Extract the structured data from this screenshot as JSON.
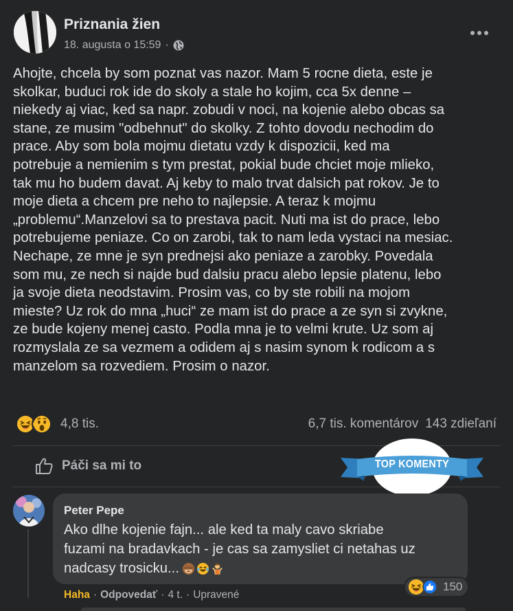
{
  "post": {
    "page_name": "Priznania žien",
    "date": "18. augusta o 15:59",
    "separator": "·",
    "privacy_icon": "globe-icon",
    "text": "Ahojte, chcela by som poznat vas nazor. Mam 5 rocne dieta, este je\nskolkar, buduci rok ide do skoly a stale ho kojim, cca 5x denne –\nniekedy aj viac, ked sa napr. zobudi v noci, na kojenie alebo obcas sa\nstane, ze musim \"odbehnut\" do skolky.  Z tohto dovodu nechodim do\nprace. Aby som bola mojmu dietatu vzdy k dispozicii, ked ma\npotrebuje a nemienim s tym prestat, pokial bude chciet moje mlieko,\ntak mu ho budem davat. Aj keby to malo trvat dalsich pat rokov. Je to\nmoje dieta a chcem pre neho to najlepsie. A teraz k mojmu\n„problemu“.Manzelovi sa to prestava pacit. Nuti ma ist do prace, lebo\npotrebujeme peniaze. Co on zarobi, tak to nam leda vystaci na mesiac.\nNechape, ze mne je syn prednejsi ako peniaze a zarobky. Povedala\nsom mu, ze nech si najde bud dalsiu pracu alebo lepsie platenu, lebo\nja svoje dieta neodstavim. Prosim vas, co by ste robili na mojom\nmieste? Uz rok do mna „huci“ ze mam ist do prace a ze syn si zvykne,\nze bude kojeny menej casto. Podla mna je to velmi krute. Uz som aj\nrozmyslala ze sa vezmem a odidem aj s nasim synom k rodicom a s\nmanzelom sa rozvediem. Prosim o nazor.",
    "reactions_count": "4,8 tis.",
    "reaction_icons": [
      "haha-icon",
      "wow-icon"
    ],
    "comments_count": "6,7 tis. komentárov",
    "shares_count": "143 zdieľaní"
  },
  "actions": {
    "like_label": "Páči sa mi to"
  },
  "badge": {
    "label": "TOP KOMENTY"
  },
  "comment": {
    "author": "Peter Pepe",
    "text": "Ako dlhe kojenie fajn... ale ked ta maly cavo skriabe\nfuzami na bradavkach - je cas sa zamysliet ci netahas uz\nnadcasy trosicku...",
    "emojis": [
      "see-no-evil-monkey-icon",
      "tears-of-joy-icon",
      "person-shrugging-icon"
    ],
    "reaction_count": "150",
    "reaction_icons": [
      "haha-icon",
      "like-icon"
    ],
    "user_reaction": "Haha",
    "reply_label": "Odpovedať",
    "time": "4 t.",
    "edited": "Upravené",
    "separator": "·"
  },
  "colors": {
    "background": "#242526",
    "text": "#e4e6eb",
    "secondary_text": "#b0b3b8",
    "comment_bubble": "#3a3b3c",
    "haha_yellow": "#f7b928",
    "like_blue": "#1877f2",
    "badge_blue": "#4a9fd8"
  }
}
